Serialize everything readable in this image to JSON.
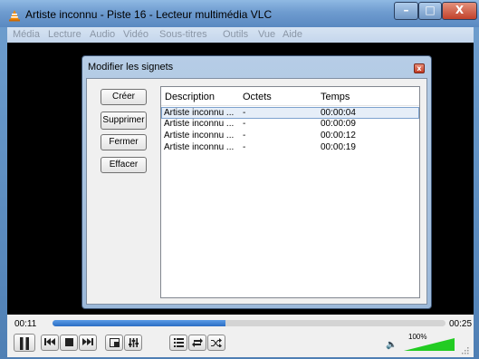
{
  "window": {
    "title": "Artiste inconnu - Piste 16 - Lecteur multimédia VLC",
    "minimize_label": "–",
    "maximize_label": "□",
    "close_label": "X"
  },
  "menu": [
    "Média",
    "Lecture",
    "Audio",
    "Vidéo",
    "Sous-titres",
    "Outils",
    "Vue",
    "Aide"
  ],
  "dialog": {
    "title": "Modifier les signets",
    "close_label": "x",
    "buttons": [
      "Créer",
      "Supprimer",
      "Fermer",
      "Effacer"
    ],
    "columns": [
      "Description",
      "Octets",
      "Temps"
    ],
    "rows": [
      {
        "description": "Artiste inconnu ...",
        "octets": "-",
        "temps": "00:00:04",
        "selected": true
      },
      {
        "description": "Artiste inconnu ...",
        "octets": "-",
        "temps": "00:00:09",
        "selected": false
      },
      {
        "description": "Artiste inconnu ...",
        "octets": "-",
        "temps": "00:00:12",
        "selected": false
      },
      {
        "description": "Artiste inconnu ...",
        "octets": "-",
        "temps": "00:00:19",
        "selected": false
      }
    ]
  },
  "player": {
    "elapsed": "00:11",
    "total": "00:25",
    "progress_fraction": 0.44,
    "volume": "100%",
    "volume_fraction": 1.0
  },
  "colors": {
    "accent": "#2a6dc4",
    "volume": "#22cc22"
  }
}
